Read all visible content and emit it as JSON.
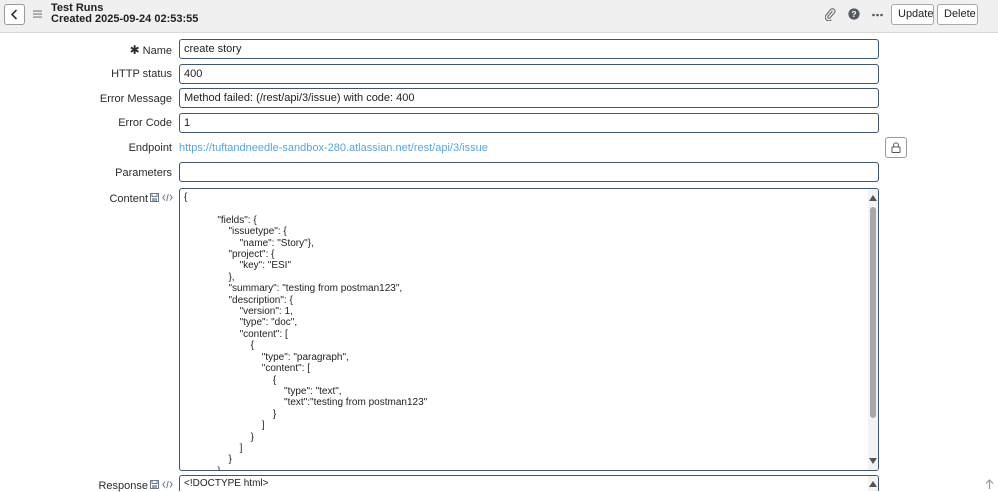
{
  "header": {
    "title": "Test Runs",
    "subtitle": "Created 2025-09-24 02:53:55",
    "update_label": "Update",
    "delete_label": "Delete"
  },
  "form": {
    "name": {
      "label": "Name",
      "required_mark": "✱",
      "value": "create story"
    },
    "http_status": {
      "label": "HTTP status",
      "value": "400"
    },
    "error_message": {
      "label": "Error Message",
      "value": "Method failed: (/rest/api/3/issue) with code: 400"
    },
    "error_code": {
      "label": "Error Code",
      "value": "1"
    },
    "endpoint": {
      "label": "Endpoint",
      "value": "https://tuftandneedle-sandbox-280.atlassian.net/rest/api/3/issue"
    },
    "parameters": {
      "label": "Parameters",
      "value": ""
    },
    "content": {
      "label": "Content",
      "value": "{\n\n            \"fields\": {\n                \"issuetype\": {\n                    \"name\": \"Story\"},\n                \"project\": {\n                    \"key\": \"ESI\"\n                },\n                \"summary\": \"testing from postman123\",\n                \"description\": {\n                    \"version\": 1,\n                    \"type\": \"doc\",\n                    \"content\": [\n                        {\n                            \"type\": \"paragraph\",\n                            \"content\": [\n                                {\n                                    \"type\": \"text\",\n                                    \"text\":\"testing from postman123\"\n                                }\n                            ]\n                        }\n                    ]\n                }\n            }"
    },
    "response": {
      "label": "Response",
      "value": "<!DOCTYPE html>"
    }
  },
  "colors": {
    "link": "#5aa6d6",
    "field_border": "#3f5670",
    "header_bg": "#f0f0f0"
  },
  "icons": {
    "back": "chevron-left-icon",
    "menu": "hamburger-icon",
    "attachment": "paperclip-icon",
    "help": "help-icon",
    "more": "more-options-icon",
    "lock": "lock-icon",
    "save_field": "save-icon",
    "code_view": "code-icon",
    "scroll_top": "arrow-up-icon"
  }
}
